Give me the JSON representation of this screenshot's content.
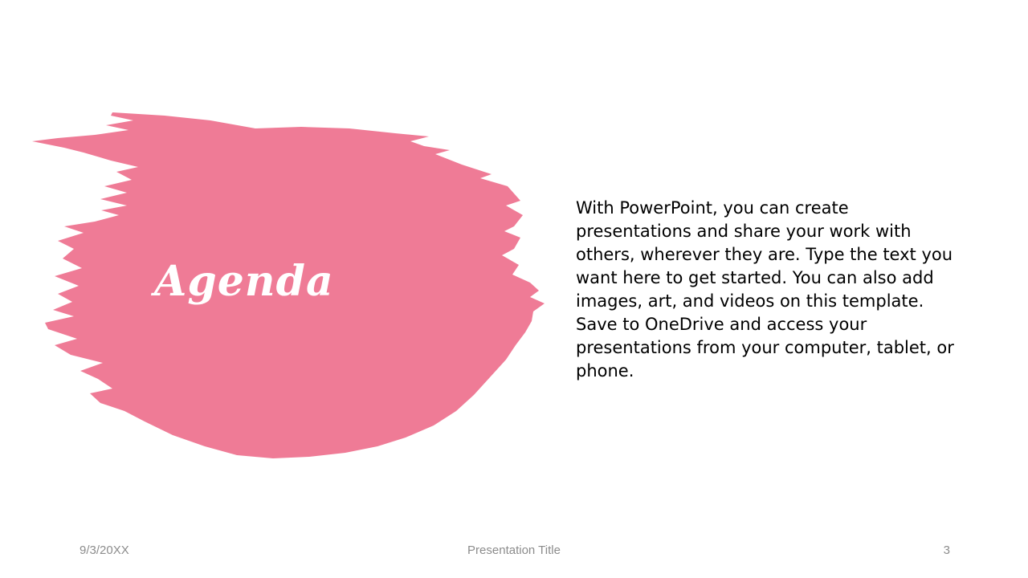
{
  "slide": {
    "title": "Agenda",
    "body": "With PowerPoint, you can create presentations and share your work with others, wherever they are. Type the text you want here to get started. You can also add images, art, and videos on this template. Save to OneDrive and access your presentations from your computer, tablet, or phone.",
    "accent_color": "#ef7b96"
  },
  "footer": {
    "date": "9/3/20XX",
    "presentation_title": "Presentation Title",
    "page_number": "3"
  }
}
